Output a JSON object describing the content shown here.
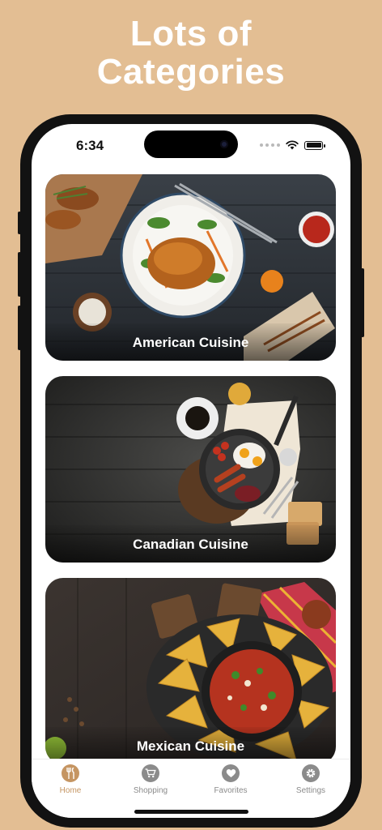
{
  "headline": {
    "line1": "Lots of",
    "line2": "Categories"
  },
  "status_bar": {
    "time": "6:34"
  },
  "categories": [
    {
      "title": "American Cuisine"
    },
    {
      "title": "Canadian Cuisine"
    },
    {
      "title": "Mexican Cuisine"
    }
  ],
  "tab_bar": {
    "tabs": [
      {
        "label": "Home",
        "icon": "utensils-icon",
        "active": true
      },
      {
        "label": "Shopping",
        "icon": "cart-icon",
        "active": false
      },
      {
        "label": "Favorites",
        "icon": "heart-icon",
        "active": false
      },
      {
        "label": "Settings",
        "icon": "gear-icon",
        "active": false
      }
    ]
  },
  "colors": {
    "background": "#E3BE93",
    "accent": "#C59562",
    "inactive": "#8B8B8B"
  }
}
